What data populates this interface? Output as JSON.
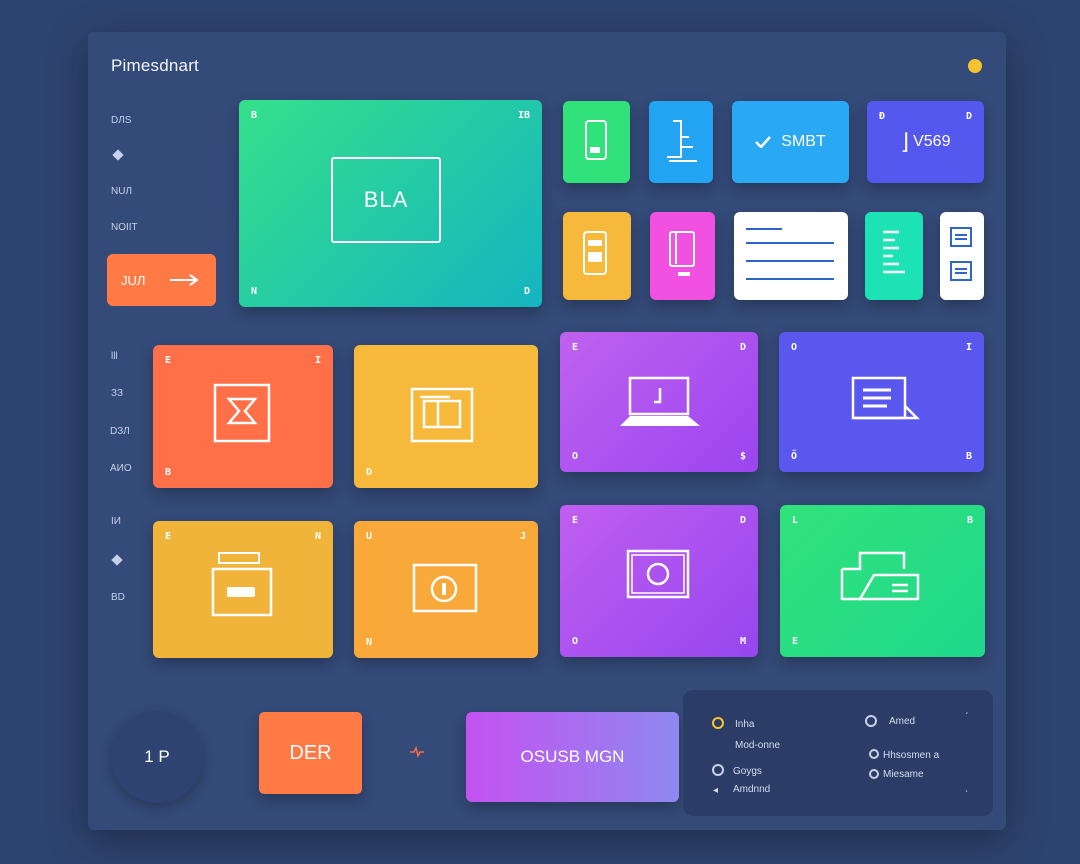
{
  "app": {
    "title": "Pimesdnart"
  },
  "sidebar": {
    "labels": [
      "DЛS",
      "NUЛ",
      "NOIIT"
    ],
    "cta": "JUЛ"
  },
  "left_labels": [
    "lll",
    "ЗЗ",
    "DЗЛ",
    "AИO",
    "IИ",
    "BD"
  ],
  "hero": {
    "label": "BLA"
  },
  "small_tiles": {
    "smbt": "SMBT",
    "v569": "V569"
  },
  "tile_corners": [
    "B",
    "IB",
    "N",
    "D",
    "E",
    "O",
    "Ð",
    "D",
    "E",
    "D",
    "O",
    "I",
    "Ő",
    "$",
    "B",
    "I",
    "B",
    "L",
    "B",
    "E",
    "M",
    "U",
    "J",
    "N",
    "M"
  ],
  "bottom": {
    "badge": "1 P",
    "der_button": "DER",
    "gradient_button": "OSUSB MGN"
  },
  "info_panel": {
    "left": [
      {
        "title": "Inha",
        "sub": "Mod-onne"
      },
      {
        "title": "Goygs",
        "sub": "Amdnnd"
      }
    ],
    "right": [
      {
        "title": "Amed"
      },
      {
        "title": "Hhsosmen a"
      },
      {
        "title": "Miesame"
      }
    ]
  },
  "colors": {
    "background": "#2e4470",
    "panel": "#344a78",
    "green": "#2fd98d",
    "orange": "#ff7a45",
    "yellow": "#f6b93b",
    "purple": "#a955f0",
    "indigo": "#5b5ef0",
    "blue": "#22a4f2"
  }
}
